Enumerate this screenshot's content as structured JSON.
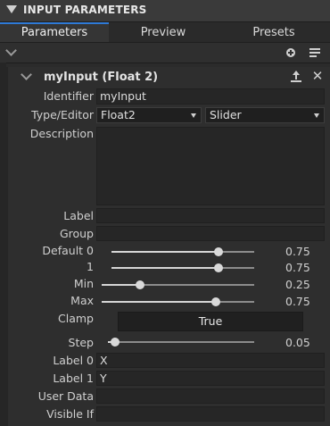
{
  "header": {
    "title": "INPUT PARAMETERS"
  },
  "tabs": [
    {
      "label": "Parameters",
      "active": true
    },
    {
      "label": "Preview",
      "active": false
    },
    {
      "label": "Presets",
      "active": false
    }
  ],
  "item": {
    "name": "myInput",
    "type_suffix": "(Float 2)",
    "title": "myInput (Float 2)"
  },
  "fields": {
    "identifier": {
      "label": "Identifier",
      "value": "myInput"
    },
    "type_editor": {
      "label": "Type/Editor",
      "type_value": "Float2",
      "editor_value": "Slider"
    },
    "description": {
      "label": "Description",
      "value": ""
    },
    "label": {
      "label": "Label",
      "value": ""
    },
    "group": {
      "label": "Group",
      "value": ""
    },
    "default0": {
      "label": "Default 0",
      "value": "0.75",
      "fraction": 0.75
    },
    "default1": {
      "label": "1",
      "value": "0.75",
      "fraction": 0.75
    },
    "min": {
      "label": "Min",
      "value": "0.25",
      "fraction": 0.25
    },
    "max": {
      "label": "Max",
      "value": "0.75",
      "fraction": 0.75
    },
    "clamp": {
      "label": "Clamp",
      "value": "True"
    },
    "step": {
      "label": "Step",
      "value": "0.05",
      "fraction": 0.05
    },
    "label0": {
      "label": "Label 0",
      "value": "X"
    },
    "label1": {
      "label": "Label 1",
      "value": "Y"
    },
    "user_data": {
      "label": "User Data",
      "value": ""
    },
    "visible_if": {
      "label": "Visible If",
      "value": ""
    }
  },
  "colors": {
    "accent": "#2f7ad6",
    "background": "#2b2b2b",
    "field": "#262626"
  }
}
